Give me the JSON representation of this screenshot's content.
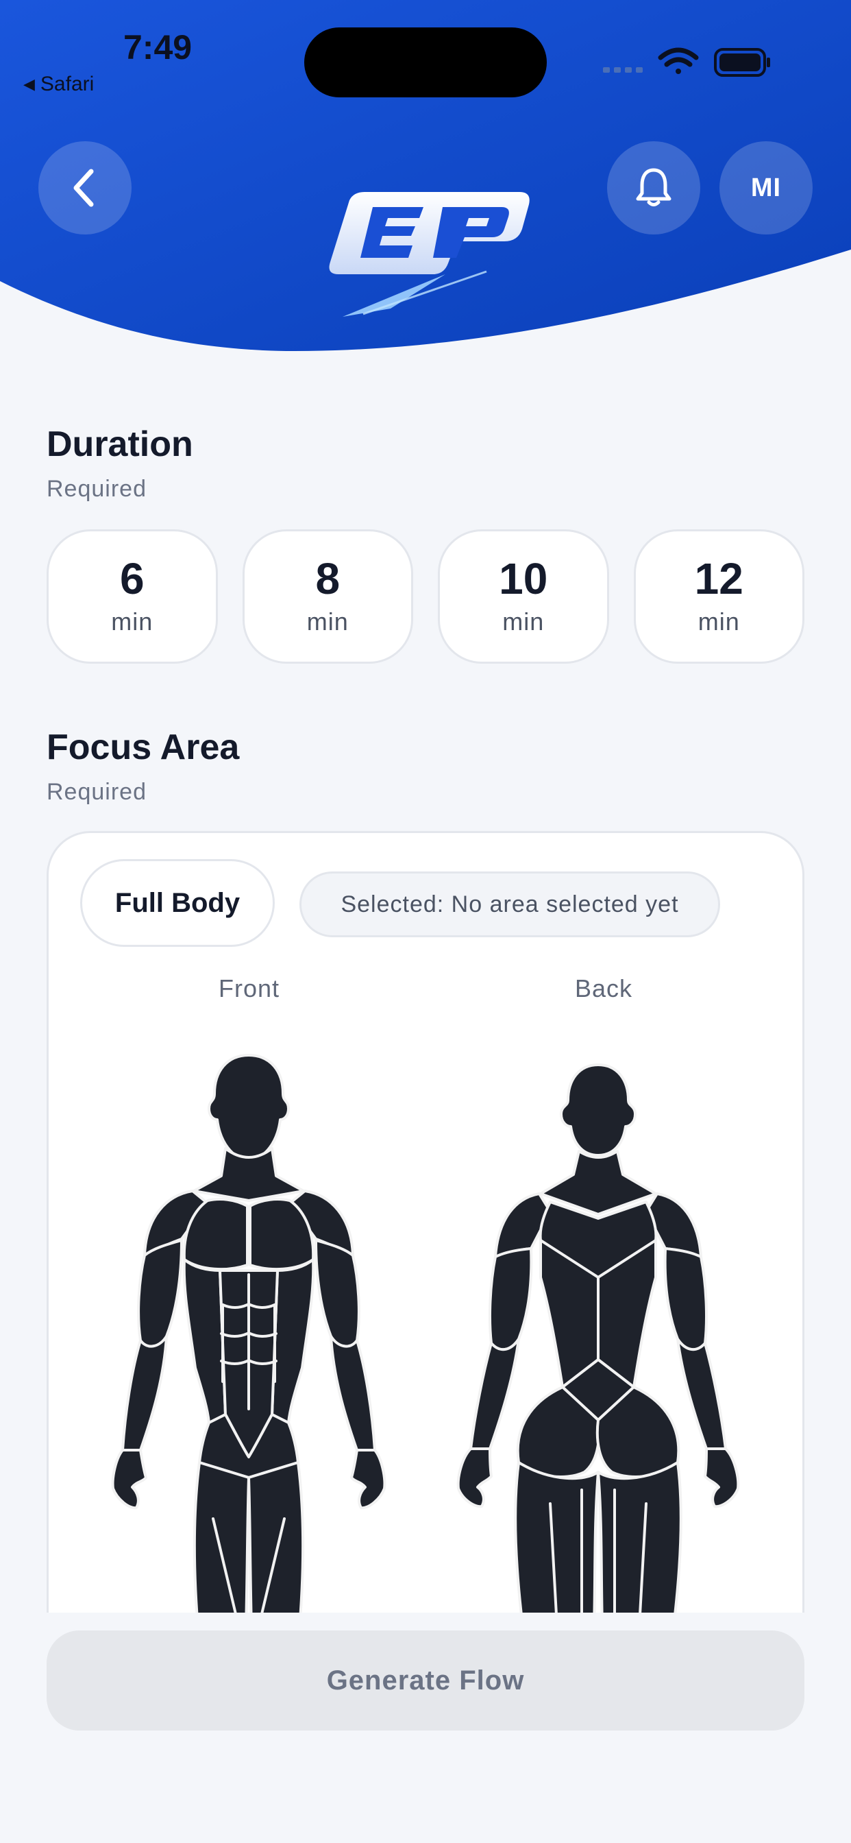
{
  "status_bar": {
    "time": "7:49",
    "back_app": "Safari"
  },
  "header": {
    "avatar_initials": "MI",
    "logo_text": "EP"
  },
  "duration": {
    "title": "Duration",
    "subtitle": "Required",
    "options": [
      {
        "value": "6",
        "unit": "min"
      },
      {
        "value": "8",
        "unit": "min"
      },
      {
        "value": "10",
        "unit": "min"
      },
      {
        "value": "12",
        "unit": "min"
      }
    ]
  },
  "focus_area": {
    "title": "Focus Area",
    "subtitle": "Required",
    "full_body_label": "Full Body",
    "selected_text": "Selected: No area selected yet",
    "front_label": "Front",
    "back_label": "Back"
  },
  "actions": {
    "generate_label": "Generate Flow"
  },
  "colors": {
    "header_blue": "#1247c8",
    "body_fill": "#1e222b",
    "muscle_outline": "#f2f2f2"
  }
}
